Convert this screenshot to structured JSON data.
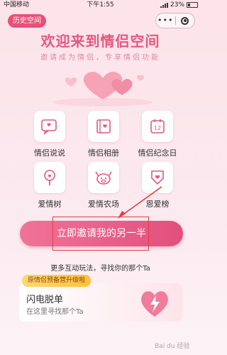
{
  "status_bar": {
    "carrier": "中国移动",
    "time": "下午1:55",
    "battery": "23%"
  },
  "top_bar": {
    "history_label": "历史空间",
    "more_icon": "more-icon",
    "close_icon": "close-icon"
  },
  "header": {
    "title": "欢迎来到情侣空间",
    "subtitle": "邀请成为情侣，专享情侣功能"
  },
  "features": [
    {
      "label": "情侣说说",
      "icon": "chat-bubble-icon"
    },
    {
      "label": "情侣相册",
      "icon": "photo-album-icon"
    },
    {
      "label": "情侣纪念日",
      "icon": "calendar-icon",
      "day": "12"
    },
    {
      "label": "爱情树",
      "icon": "tree-icon"
    },
    {
      "label": "爱情农场",
      "icon": "farm-icon"
    },
    {
      "label": "恩爱榜",
      "icon": "ranking-icon"
    }
  ],
  "invite": {
    "button_label": "立即邀请我的另一半",
    "more_text": "更多互动玩法，寻找你的那个Ta"
  },
  "banner": {
    "tag": "原情侣预备营升级啦",
    "title": "闪电脱单",
    "subtitle": "在这里寻找那个Ta"
  },
  "watermark": "Bai du 经验",
  "colors": {
    "accent": "#e4587f",
    "button": "#e2507d",
    "annotation": "#e63b3b"
  }
}
